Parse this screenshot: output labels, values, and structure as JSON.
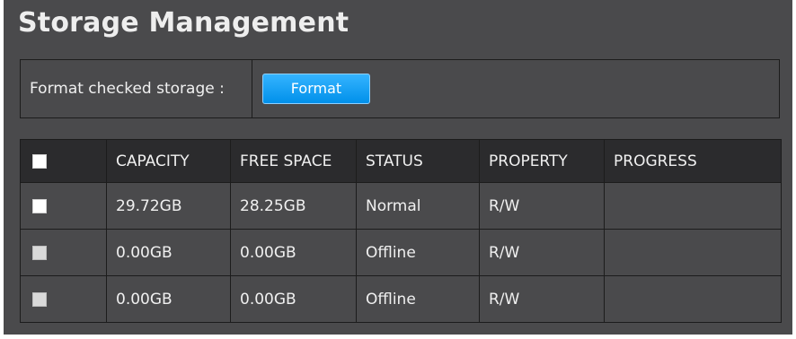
{
  "page": {
    "title": "Storage Management"
  },
  "format": {
    "label": "Format checked storage :",
    "button_label": "Format"
  },
  "table": {
    "columns": [
      "CAPACITY",
      "FREE SPACE",
      "STATUS",
      "PROPERTY",
      "PROGRESS"
    ],
    "rows": [
      {
        "checked": false,
        "enabled": true,
        "capacity": "29.72GB",
        "free_space": "28.25GB",
        "status": "Normal",
        "property": "R/W",
        "progress": ""
      },
      {
        "checked": false,
        "enabled": false,
        "capacity": "0.00GB",
        "free_space": "0.00GB",
        "status": "Offline",
        "property": "R/W",
        "progress": ""
      },
      {
        "checked": false,
        "enabled": false,
        "capacity": "0.00GB",
        "free_space": "0.00GB",
        "status": "Offline",
        "property": "R/W",
        "progress": ""
      }
    ]
  },
  "colors": {
    "panel_background": "#4a4a4c",
    "header_background": "#2b2b2d",
    "button_blue": "#1aa3f5"
  }
}
